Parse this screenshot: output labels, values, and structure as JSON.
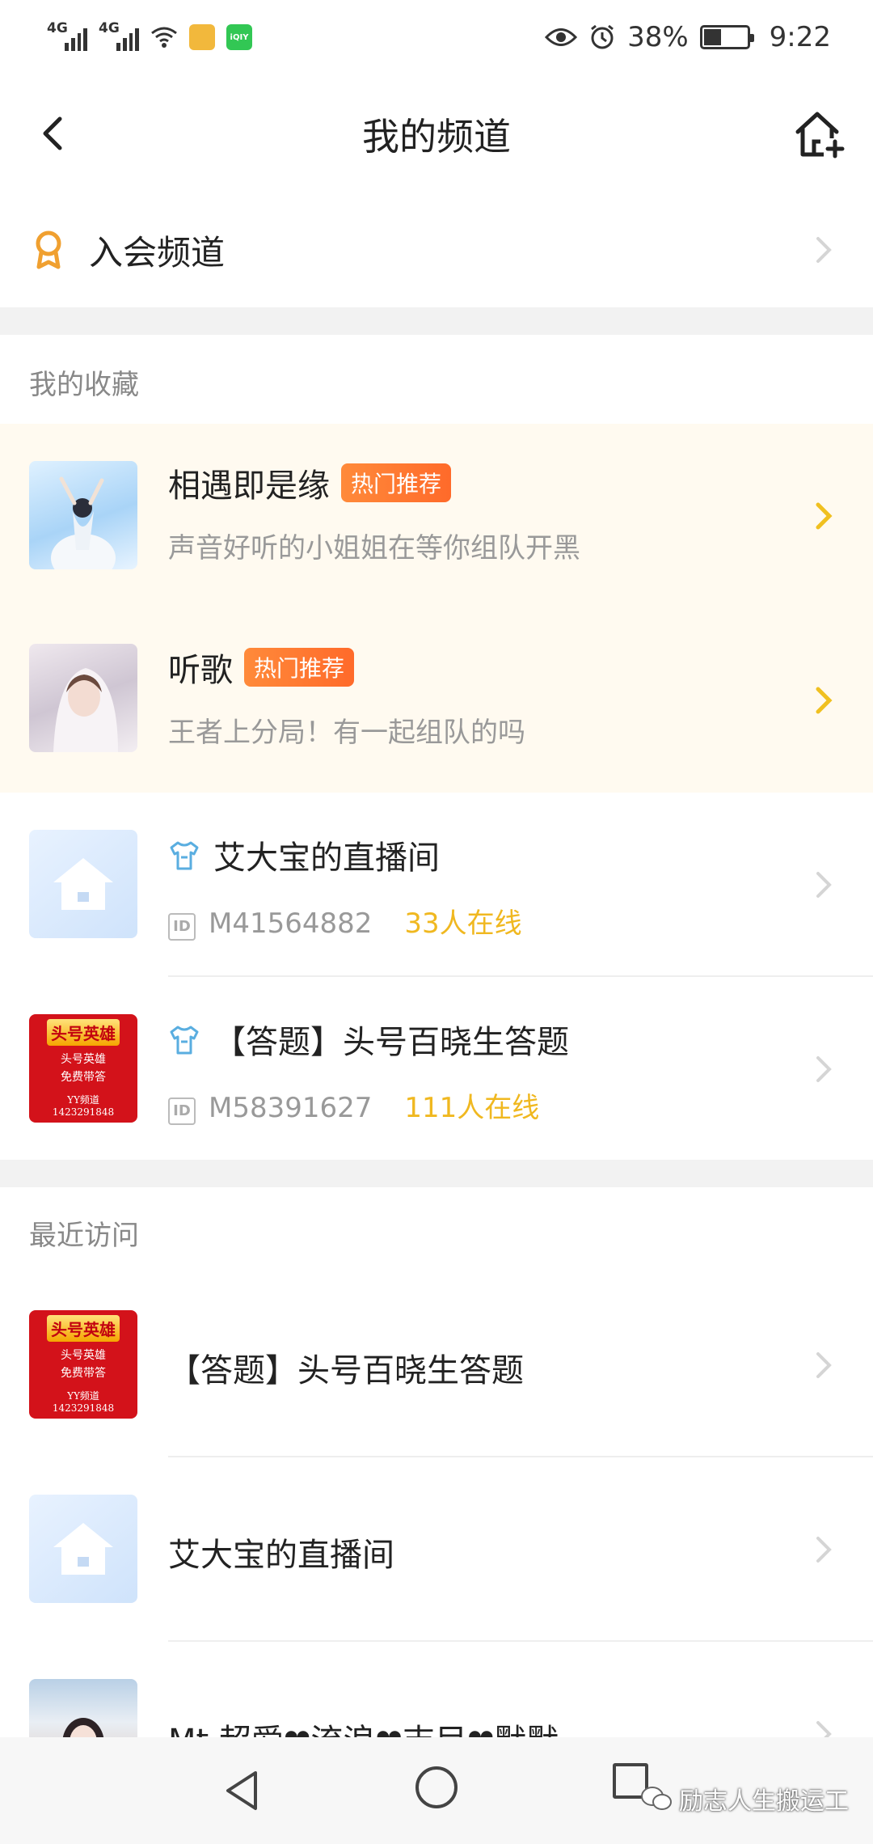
{
  "status_bar": {
    "net1": "4G",
    "net2": "4G",
    "battery_pct": "38%",
    "time": "9:22",
    "battery_level": 0.38,
    "app_icon_label": "iQIY"
  },
  "header": {
    "title": "我的频道"
  },
  "join": {
    "label": "入会频道"
  },
  "favorites": {
    "section_title": "我的收藏",
    "items": [
      {
        "name": "相遇即是缘",
        "badge": "热门推荐",
        "desc": "声音好听的小姐姐在等你组队开黑"
      },
      {
        "name": "听歌",
        "badge": "热门推荐",
        "desc": "王者上分局！有一起组队的吗"
      },
      {
        "name": "艾大宝的直播间",
        "id_icon": "ID",
        "id": "M41564882",
        "online": "33人在线"
      },
      {
        "name": "【答题】头号百晓生答题",
        "id_icon": "ID",
        "id": "M58391627",
        "online": "111人在线"
      }
    ]
  },
  "recent": {
    "section_title": "最近访问",
    "items": [
      {
        "name": "【答题】头号百晓生答题"
      },
      {
        "name": "艾大宝的直播间"
      },
      {
        "name": "Mt 超爱❤流浪❤吉目❤默默"
      }
    ]
  },
  "thumb_text": {
    "logo": "头号英雄",
    "line1": "头号英雄",
    "line2": "免费带答",
    "line3": "YY频道",
    "line4": "1423291848"
  },
  "watermark": "励志人生搬运工",
  "colors": {
    "badge": "#ff7a30",
    "online": "#f0b820",
    "hot_bg": "#fffaf0",
    "join_icon": "#f0a030"
  }
}
